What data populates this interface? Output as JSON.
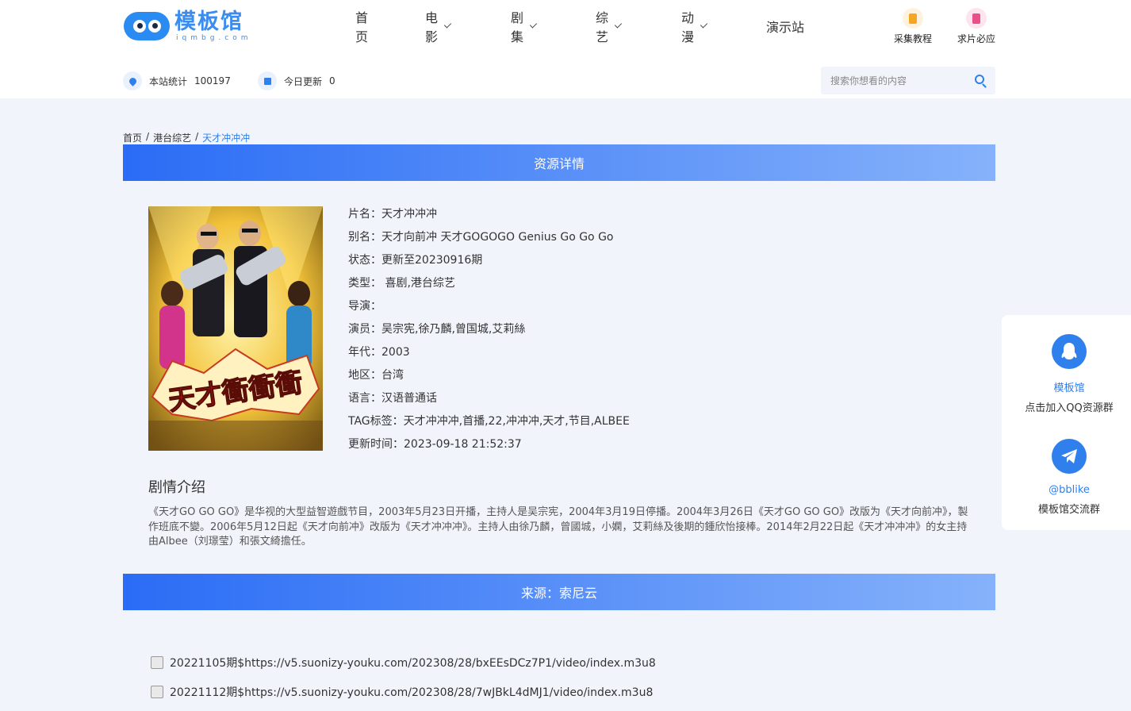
{
  "header": {
    "logo_text": "模板馆",
    "logo_sub": "iqmbg.com",
    "nav": [
      {
        "label": "首页",
        "dropdown": false
      },
      {
        "label": "电影",
        "dropdown": true
      },
      {
        "label": "剧集",
        "dropdown": true
      },
      {
        "label": "综艺",
        "dropdown": true
      },
      {
        "label": "动漫",
        "dropdown": true
      },
      {
        "label": "演示站",
        "dropdown": false
      }
    ],
    "tools": [
      {
        "label": "采集教程",
        "icon": "document-icon",
        "color": "#f5a623"
      },
      {
        "label": "求片必应",
        "icon": "film-request-icon",
        "color": "#e8508a"
      }
    ],
    "stats": [
      {
        "label": "本站统计",
        "value": "100197",
        "icon": "heart-icon"
      },
      {
        "label": "今日更新",
        "value": "0",
        "icon": "calendar-icon"
      }
    ],
    "search_placeholder": "搜索你想看的内容"
  },
  "breadcrumb": [
    "首页",
    "港台综艺",
    "天才冲冲冲"
  ],
  "detail": {
    "banner": "资源详情",
    "rows": [
      {
        "label": "片名：",
        "value": "天才冲冲冲"
      },
      {
        "label": "别名：",
        "value": "天才向前冲 天才GOGOGO Genius Go Go Go"
      },
      {
        "label": "状态：",
        "value": "更新至20230916期"
      },
      {
        "label": "类型：",
        "value": " 喜剧,港台综艺"
      },
      {
        "label": "导演：",
        "value": ""
      },
      {
        "label": "演员：",
        "value": "吴宗宪,徐乃麟,曾国城,艾莉絲"
      },
      {
        "label": "年代：",
        "value": "2003"
      },
      {
        "label": "地区：",
        "value": "台湾"
      },
      {
        "label": "语言：",
        "value": "汉语普通话"
      },
      {
        "label": "TAG标签：",
        "value": "天才冲冲冲,首播,22,冲冲冲,天才,节目,ALBEE"
      },
      {
        "label": "更新时间：",
        "value": "2023-09-18 21:52:37"
      }
    ],
    "poster_text": "天才衝衝衝"
  },
  "plot": {
    "title": "剧情介绍",
    "text": "《天才GO GO GO》是华视的大型益智遊戲节目，2003年5月23日开播，主持人是吴宗宪，2004年3月19日停播。2004年3月26日《天才GO GO GO》改版为《天才向前冲》，製作班底不變。2006年5月12日起《天才向前冲》改版为《天才冲冲冲》。主持人由徐乃麟，曾國城，小嫻，艾莉絲及後期的鍾欣怡接棒。2014年2月22日起《天才冲冲冲》的女主持由Albee（刘璟莹）和張文綺擔任。"
  },
  "source": {
    "banner": "来源：索尼云",
    "episodes": [
      "20221105期$https://v5.suonizy-youku.com/202308/28/bxEEsDCz7P1/video/index.m3u8",
      "20221112期$https://v5.suonizy-youku.com/202308/28/7wJBkL4dMJ1/video/index.m3u8"
    ]
  },
  "float_panel": {
    "items": [
      {
        "name": "模板馆",
        "desc": "点击加入QQ资源群",
        "icon": "qq-icon"
      },
      {
        "name": "@bblike",
        "desc": "模板馆交流群",
        "icon": "telegram-icon"
      }
    ]
  },
  "colors": {
    "accent": "#2f80ed",
    "banner_start": "#2a6cf5",
    "banner_end": "#86b2fb",
    "page_bg": "#f1f4fb"
  }
}
